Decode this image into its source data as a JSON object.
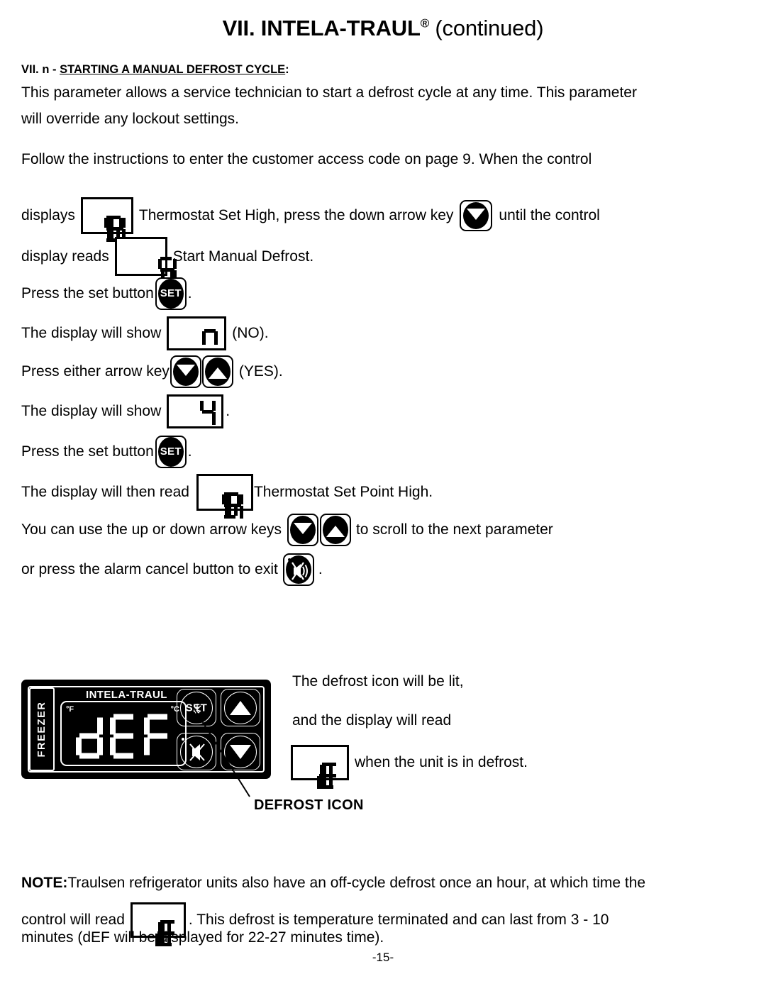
{
  "header": {
    "title_prefix": "VII. INTELA-TRAUL",
    "registered_mark": "®",
    "title_suffix": " (continued)"
  },
  "section": {
    "number": "VII. n - ",
    "heading": "STARTING A MANUAL DEFROST CYCLE",
    "colon": ":"
  },
  "paragraphs": {
    "p1_line1": "This parameter allows a service technician to start a defrost cycle at any time. This parameter",
    "p1_line2": "will override any lockout settings.",
    "p2_line1": "Follow the instructions to enter the customer access code on page 9. When the control"
  },
  "steps": {
    "s1_pre": "displays",
    "s1_mid": "Thermostat Set High, press the down arrow key",
    "s1_post": "until the control",
    "s2_pre": "display reads",
    "s2_post": "Start Manual Defrost.",
    "s3_pre": "Press the set button",
    "s3_post": ".",
    "s4_pre": "The display will show",
    "s4_post": "(NO).",
    "s5_pre": "Press either arrow key",
    "s5_post": "(YES).",
    "s6_pre": "The display will show",
    "s6_post": ".",
    "s7_pre": "Press the set button",
    "s7_post": ".",
    "s8_pre": "The display will then read",
    "s8_post": "Thermostat Set Point High.",
    "s9_pre": "You can use the up or down arrow keys",
    "s9_post": "to scroll to the next parameter",
    "s10_pre": "or press the alarm cancel button to exit",
    "s10_post": "."
  },
  "displays": {
    "sph": "SPH",
    "sd": "Sd",
    "n": "n",
    "y": "4",
    "def": "dEF"
  },
  "buttons": {
    "set_label": "SET",
    "down_arrow": "down-arrow",
    "up_arrow": "up-arrow",
    "alarm_cancel": "alarm-cancel"
  },
  "panel": {
    "compartment_label": "FREEZER",
    "brand": "INTELA-TRAUL",
    "unit_f": "°F",
    "unit_c": "°C",
    "display_value": "dEF",
    "set_label": "SET",
    "up_label": "up-arrow",
    "down_label": "down-arrow",
    "alarm_label": "alarm-cancel",
    "defrost_icon_label": "defrost-snowflake"
  },
  "callout": {
    "defrost_icon_text": "DEFROST ICON",
    "right_line1": "The defrost icon will be lit,",
    "right_line2": "and the display will read",
    "right_line3": "when the unit is in defrost."
  },
  "note": {
    "label": "NOTE:",
    "line1": " Traulsen refrigerator units also have an off-cycle defrost once an hour, at which time the",
    "line2_pre": "control will read",
    "line2_post": ".   This defrost is temperature terminated and can last from 3 - 10",
    "line3": "minutes (dEF will be displayed for 22-27 minutes time)."
  },
  "footer": {
    "page_number": "-15-"
  },
  "colors": {
    "ink": "#000000",
    "paper": "#ffffff",
    "panel_bg": "#000000",
    "panel_fg": "#ffffff"
  }
}
